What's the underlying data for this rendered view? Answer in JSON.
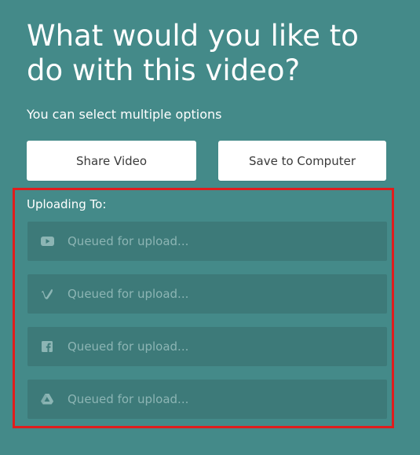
{
  "heading": "What would you like to do with this video?",
  "subtitle": "You can select multiple options",
  "buttons": {
    "share": "Share Video",
    "save": "Save to Computer"
  },
  "uploading": {
    "label": "Uploading To:",
    "destinations": [
      {
        "icon": "youtube-icon",
        "status": "Queued for upload..."
      },
      {
        "icon": "vimeo-icon",
        "status": "Queued for upload..."
      },
      {
        "icon": "facebook-icon",
        "status": "Queued for upload..."
      },
      {
        "icon": "google-drive-icon",
        "status": "Queued for upload..."
      }
    ]
  },
  "colors": {
    "background": "#448a89",
    "row_background": "#3d7a79",
    "highlight_border": "#e01d1d",
    "status_text": "#8cb5b4"
  }
}
